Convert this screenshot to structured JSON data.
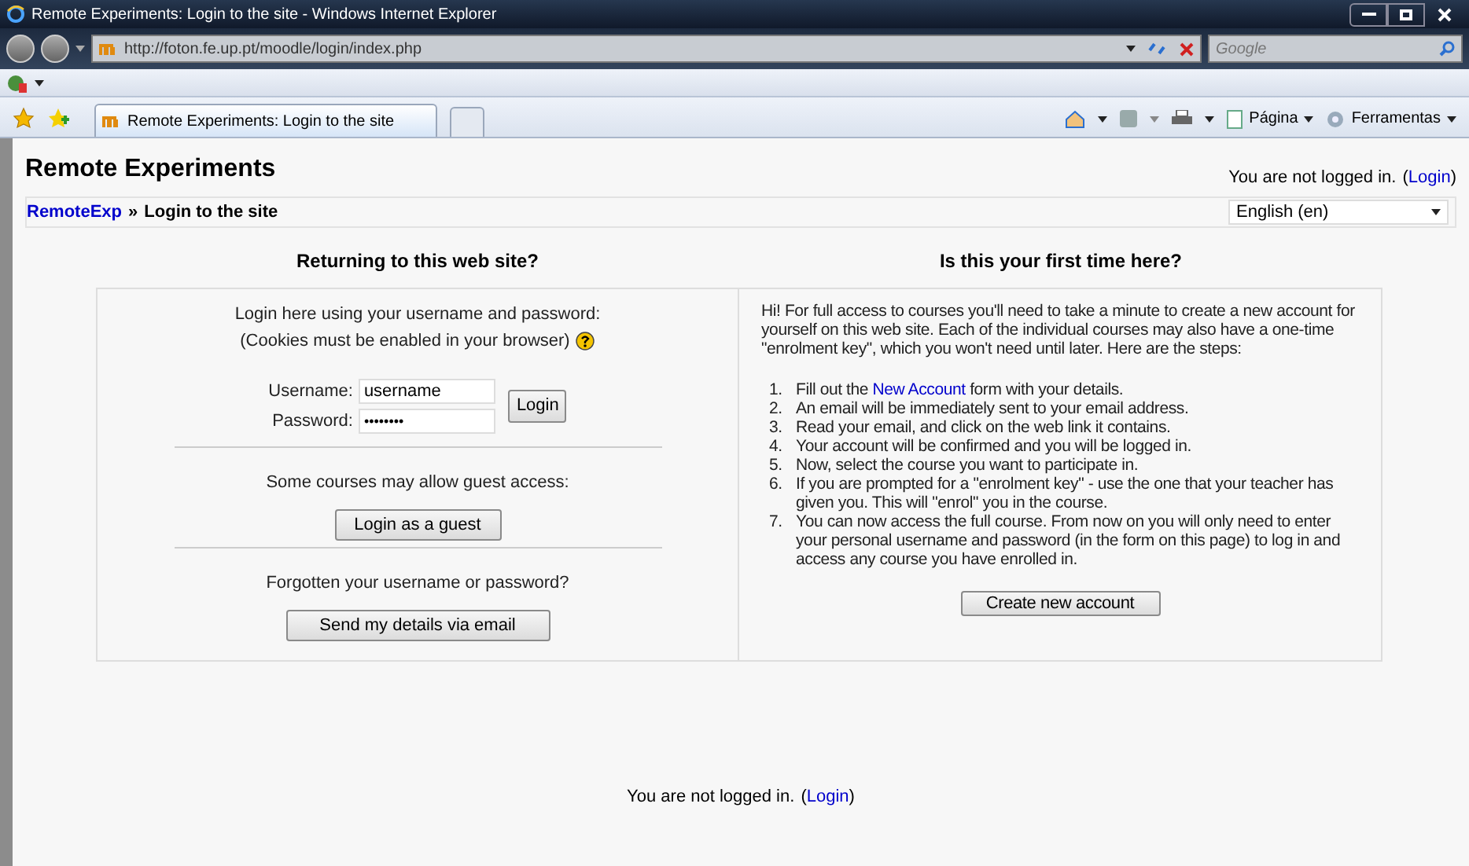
{
  "window": {
    "title": "Remote Experiments: Login to the site - Windows Internet Explorer"
  },
  "address_bar": {
    "url": "http://foton.fe.up.pt/moodle/login/index.php"
  },
  "search": {
    "placeholder": "Google"
  },
  "tabs": [
    {
      "label": "Remote Experiments: Login to the site",
      "selected": true
    }
  ],
  "command_bar": [
    {
      "label": "Página"
    },
    {
      "label": "Ferramentas"
    }
  ],
  "page": {
    "site_title": "Remote Experiments",
    "login_info": {
      "text": "You are not logged in.",
      "open": "(",
      "link": "Login",
      "close": ")"
    },
    "breadcrumb": {
      "link": "RemoteExp",
      "separator": "»",
      "current": "Login to the site"
    },
    "language": {
      "value": "English (en)"
    },
    "returning": {
      "heading": "Returning to this web site?",
      "intro": [
        "Login here using your username and password:",
        "(Cookies must be enabled in your browser)"
      ],
      "username_label": "Username:",
      "username_value": "username",
      "password_label": "Password:",
      "password_value": "••••••••",
      "login_button": "Login",
      "guest_text": "Some courses may allow guest access:",
      "guest_button": "Login as a guest",
      "forgot_text": "Forgotten your username or password?",
      "forgot_button": "Send my details via email"
    },
    "first_time": {
      "heading": "Is this your first time here?",
      "intro": "Hi! For full access to courses you'll need to take a minute to create a new account for yourself on this web site. Each of the individual courses may also have a one-time \"enrolment key\", which you won't need until later. Here are the steps:",
      "steps": [
        {
          "number": "1.",
          "before": "Fill out the ",
          "link": "New Account",
          "after": " form with your details."
        },
        {
          "number": "2.",
          "before": "An email will be immediately sent to your email address."
        },
        {
          "number": "3.",
          "before": "Read your email, and click on the web link it contains."
        },
        {
          "number": "4.",
          "before": "Your account will be confirmed and you will be logged in."
        },
        {
          "number": "5.",
          "before": "Now, select the course you want to participate in."
        },
        {
          "number": "6.",
          "before": "If you are prompted for a \"enrolment key\" - use the one that your teacher has given you. This will \"enrol\" you in the course."
        },
        {
          "number": "7.",
          "before": "You can now access the full course. From now on you will only need to enter your personal username and password (in the form on this page) to log in and access any course you have enrolled in."
        }
      ],
      "button": "Create new account"
    },
    "footer": {
      "text": "You are not logged in.",
      "open": "(",
      "link": "Login",
      "close": ")"
    }
  }
}
